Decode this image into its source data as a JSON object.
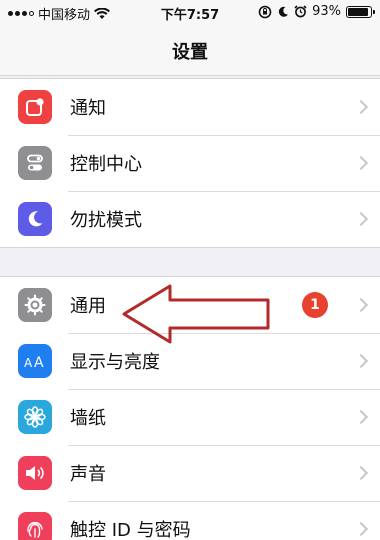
{
  "status_bar": {
    "carrier": "中国移动",
    "time": "下午7:57",
    "battery": "93%",
    "battery_level": 0.93
  },
  "nav": {
    "title": "设置"
  },
  "groups": [
    {
      "items": [
        {
          "label": "通知",
          "icon": "notifications-icon",
          "color": "#ef4141"
        },
        {
          "label": "控制中心",
          "icon": "control-center-icon",
          "color": "#8e8e93"
        },
        {
          "label": "勿扰模式",
          "icon": "moon-icon",
          "color": "#5e5ce6"
        }
      ]
    },
    {
      "items": [
        {
          "label": "通用",
          "icon": "gear-icon",
          "color": "#8e8e93",
          "badge": "1"
        },
        {
          "label": "显示与亮度",
          "icon": "display-icon",
          "color": "#1f7ef0"
        },
        {
          "label": "墙纸",
          "icon": "wallpaper-icon",
          "color": "#2aa8de"
        },
        {
          "label": "声音",
          "icon": "speaker-icon",
          "color": "#ef3f5a"
        },
        {
          "label": "触控 ID 与密码",
          "icon": "fingerprint-icon",
          "color": "#ef3f5a"
        }
      ]
    }
  ],
  "annotation": {
    "arrow_color": "#b32a2a"
  }
}
